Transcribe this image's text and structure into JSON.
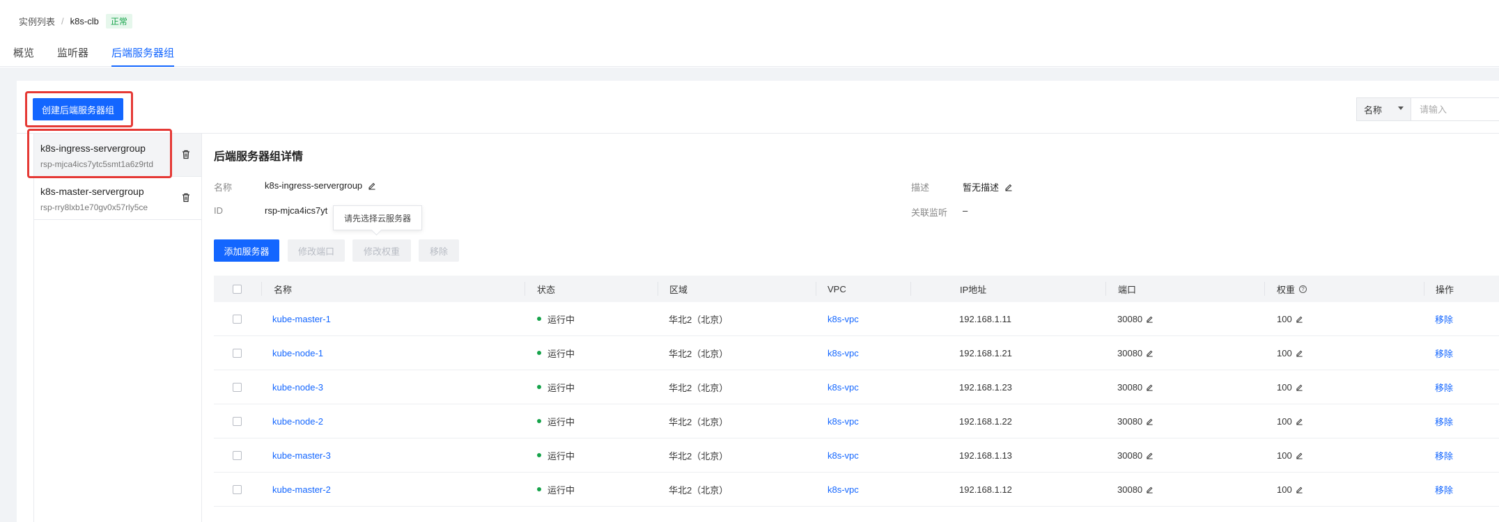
{
  "breadcrumb": {
    "parent": "实例列表",
    "separator": "/",
    "current": "k8s-clb",
    "status": "正常"
  },
  "tabs": [
    {
      "label": "概览",
      "active": false
    },
    {
      "label": "监听器",
      "active": false
    },
    {
      "label": "后端服务器组",
      "active": true
    }
  ],
  "toolbar": {
    "create_label": "创建后端服务器组"
  },
  "filter": {
    "field": "名称",
    "placeholder": "请输入"
  },
  "server_groups": [
    {
      "name": "k8s-ingress-servergroup",
      "id": "rsp-mjca4ics7ytc5smt1a6z9rtd",
      "selected": true
    },
    {
      "name": "k8s-master-servergroup",
      "id": "rsp-rry8lxb1e70gv0x57rly5ce",
      "selected": false
    }
  ],
  "detail": {
    "title": "后端服务器组详情",
    "name_label": "名称",
    "name_value": "k8s-ingress-servergroup",
    "id_label": "ID",
    "id_value": "rsp-mjca4ics7yt",
    "desc_label": "描述",
    "desc_value": "暂无描述",
    "listener_label": "关联监听",
    "listener_value": "–"
  },
  "tooltip": "请先选择云服务器",
  "actions": {
    "add": "添加服务器",
    "edit_port": "修改端口",
    "edit_weight": "修改权重",
    "remove": "移除"
  },
  "table": {
    "columns": {
      "name": "名称",
      "status": "状态",
      "region": "区域",
      "vpc": "VPC",
      "ip": "IP地址",
      "port": "端口",
      "weight": "权重",
      "ops": "操作"
    },
    "rows": [
      {
        "name": "kube-master-1",
        "status": "运行中",
        "region": "华北2（北京）",
        "vpc": "k8s-vpc",
        "ip": "192.168.1.11",
        "port": "30080",
        "weight": "100",
        "op": "移除"
      },
      {
        "name": "kube-node-1",
        "status": "运行中",
        "region": "华北2（北京）",
        "vpc": "k8s-vpc",
        "ip": "192.168.1.21",
        "port": "30080",
        "weight": "100",
        "op": "移除"
      },
      {
        "name": "kube-node-3",
        "status": "运行中",
        "region": "华北2（北京）",
        "vpc": "k8s-vpc",
        "ip": "192.168.1.23",
        "port": "30080",
        "weight": "100",
        "op": "移除"
      },
      {
        "name": "kube-node-2",
        "status": "运行中",
        "region": "华北2（北京）",
        "vpc": "k8s-vpc",
        "ip": "192.168.1.22",
        "port": "30080",
        "weight": "100",
        "op": "移除"
      },
      {
        "name": "kube-master-3",
        "status": "运行中",
        "region": "华北2（北京）",
        "vpc": "k8s-vpc",
        "ip": "192.168.1.13",
        "port": "30080",
        "weight": "100",
        "op": "移除"
      },
      {
        "name": "kube-master-2",
        "status": "运行中",
        "region": "华北2（北京）",
        "vpc": "k8s-vpc",
        "ip": "192.168.1.12",
        "port": "30080",
        "weight": "100",
        "op": "移除"
      }
    ]
  },
  "colors": {
    "primary": "#1366ff",
    "success": "#16a34a",
    "highlight": "#e53935"
  }
}
